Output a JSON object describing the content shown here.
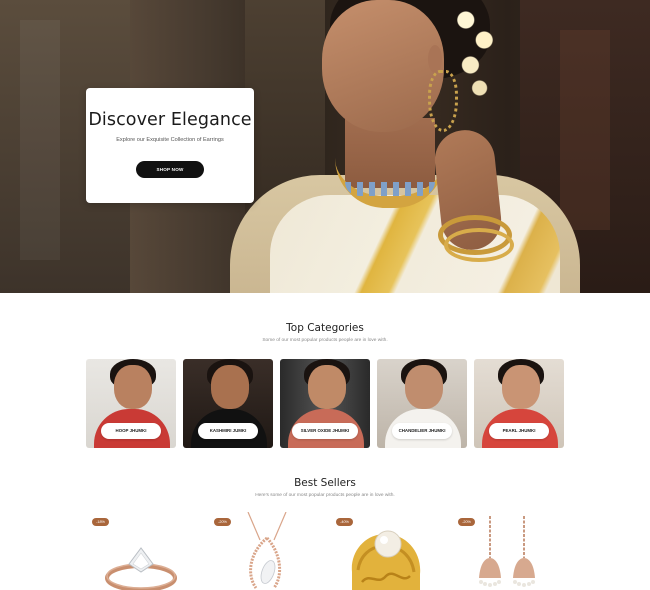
{
  "hero": {
    "title": "Discover Elegance",
    "subtitle": "Explore our Exquisite Collection of Earrings",
    "button_label": "SHOP NOW"
  },
  "categories": {
    "title": "Top Categories",
    "subtitle": "Some of our most popular products people are in love with.",
    "items": [
      {
        "label": "HOOP JHUMKI"
      },
      {
        "label": "KASHMIRI JUMKI"
      },
      {
        "label": "SILVER OXIDE JHUMKI"
      },
      {
        "label": "CHANDELIER JHUMKI"
      },
      {
        "label": "PEARL JHUMKI"
      }
    ]
  },
  "bestsellers": {
    "title": "Best Sellers",
    "subtitle": "Here's some of our most popular products people are in love with.",
    "items": [
      {
        "badge": "-18%"
      },
      {
        "badge": "-20%"
      },
      {
        "badge": "-40%"
      },
      {
        "badge": "-20%"
      }
    ]
  },
  "colors": {
    "button_bg": "#111111",
    "badge_bg": "#a9663b"
  }
}
